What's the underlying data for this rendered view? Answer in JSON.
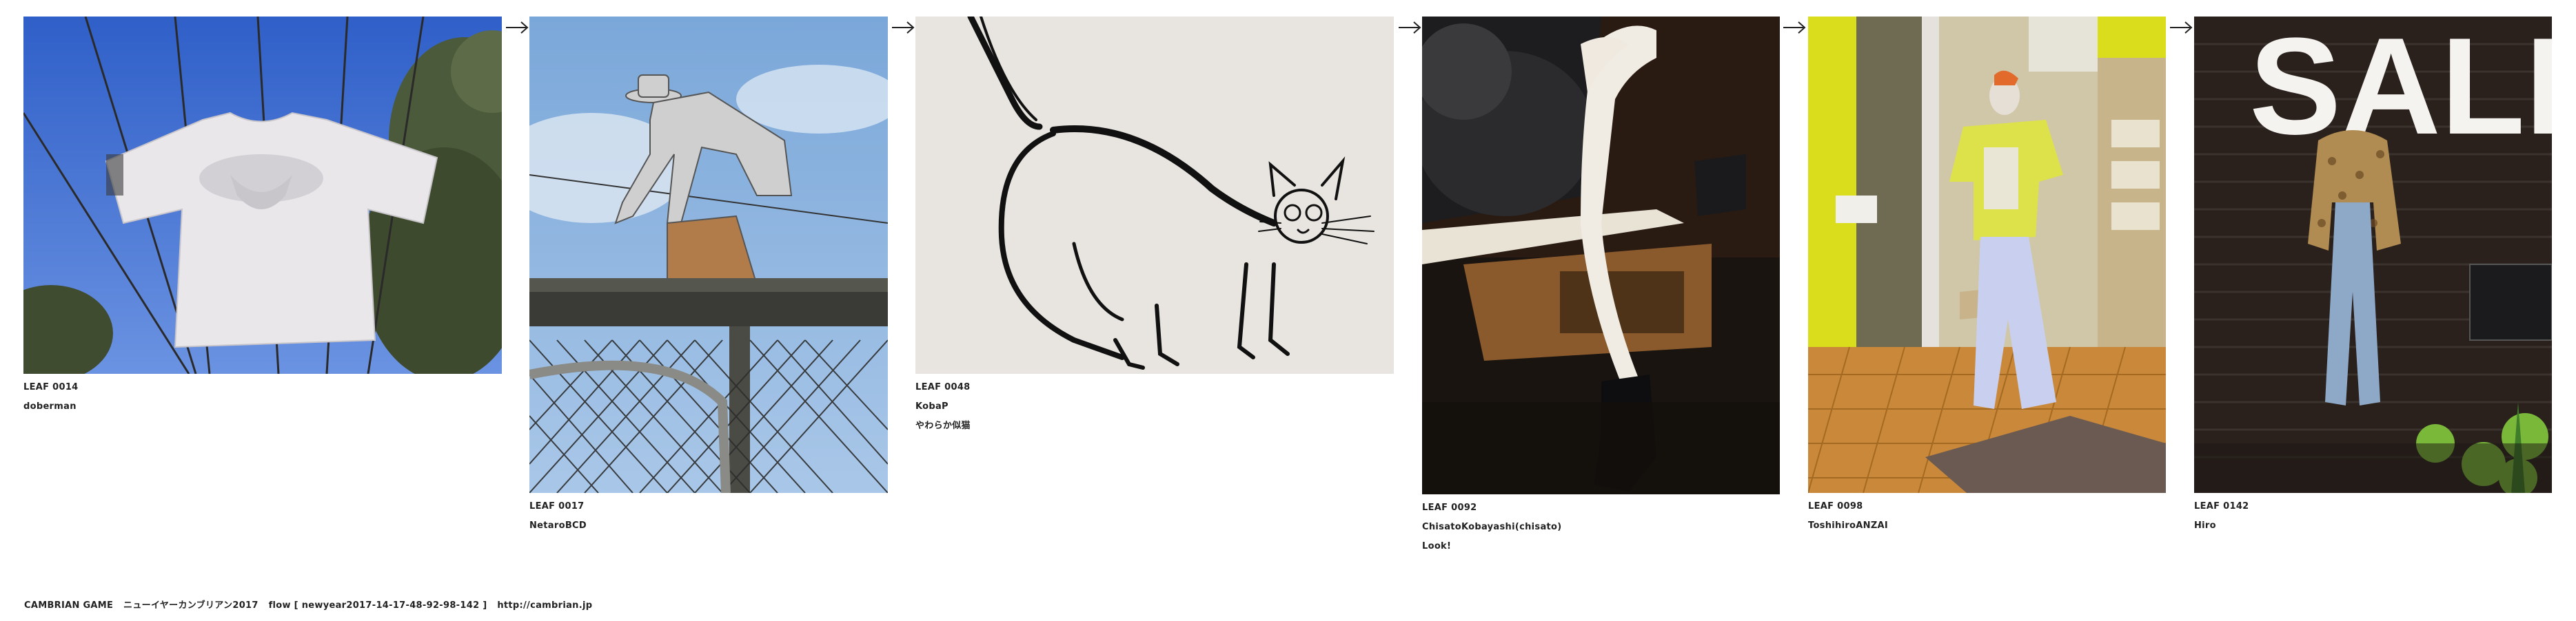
{
  "leaves": [
    {
      "number": "LEAF 0014",
      "author": "doberman",
      "subtitle": "",
      "photo": "white t-shirt hanging on wires against blue sky and trees"
    },
    {
      "number": "LEAF 0017",
      "author": "NetaroBCD",
      "subtitle": "",
      "photo": "metal cutout of crouching man on chain-link fence against sky"
    },
    {
      "number": "LEAF 0048",
      "author": "KobaP",
      "subtitle": "やわらか似猫",
      "photo": "ink line drawing of a cat on a wall"
    },
    {
      "number": "LEAF 0092",
      "author": "ChisatoKobayashi(chisato)",
      "subtitle": "Look!",
      "photo": "mannequin legs with black boots and fur in a shop window"
    },
    {
      "number": "LEAF 0098",
      "author": "ToshihiroANZAI",
      "subtitle": "",
      "photo": "mannequin in yellow shirt in a yellow shop"
    },
    {
      "number": "LEAF 0142",
      "author": "Hiro",
      "subtitle": "",
      "photo": "shop window with SALE sign, mannequin and green flowers"
    }
  ],
  "photo_text": {
    "sale_sign": "SALE"
  },
  "arrow_icon": "right-arrow-icon",
  "footer": {
    "game": "CAMBRIAN GAME",
    "title": "ニューイヤーカンブリアン2017",
    "flow": "flow [ newyear2017-14-17-48-92-98-142 ]",
    "url": "http://cambrian.jp"
  }
}
